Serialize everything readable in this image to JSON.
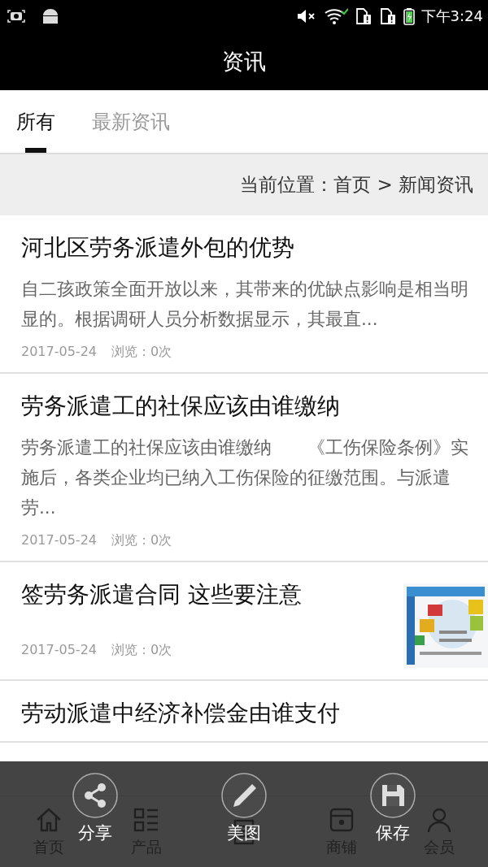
{
  "status_bar": {
    "time": "下午3:24"
  },
  "header": {
    "title": "资讯"
  },
  "tabs": [
    {
      "label": "所有",
      "selected": true
    },
    {
      "label": "最新资讯",
      "selected": false
    }
  ],
  "breadcrumb": "当前位置：首页 > 新闻资讯",
  "articles": [
    {
      "title": "河北区劳务派遣外包的优势",
      "summary": " 自二孩政策全面开放以来，其带来的优缺点影响是相当明显的。根据调研人员分析数据显示，其最直...",
      "date": "2017-05-24",
      "views": "浏览：0次"
    },
    {
      "title": "劳务派遣工的社保应该由谁缴纳",
      "summary": "劳务派遣工的社保应该由谁缴纳　　《工伤保险条例》实施后，各类企业均已纳入工伤保险的征缴范围。与派遣劳...",
      "date": "2017-05-24",
      "views": "浏览：0次"
    },
    {
      "title": "签劳务派遣合同 这些要注意",
      "date": "2017-05-24",
      "views": "浏览：0次"
    },
    {
      "title": "劳动派遣中经济补偿金由谁支付"
    }
  ],
  "nav": [
    {
      "kind": "home",
      "label": "首页"
    },
    {
      "kind": "list",
      "label": "产品"
    },
    {
      "kind": "news"
    },
    {
      "kind": "shop",
      "label": "商铺"
    },
    {
      "kind": "user",
      "label": "会员"
    }
  ],
  "actions": [
    {
      "kind": "share",
      "label": "分享"
    },
    {
      "kind": "edit",
      "label": "美图"
    },
    {
      "kind": "save",
      "label": "保存"
    }
  ]
}
